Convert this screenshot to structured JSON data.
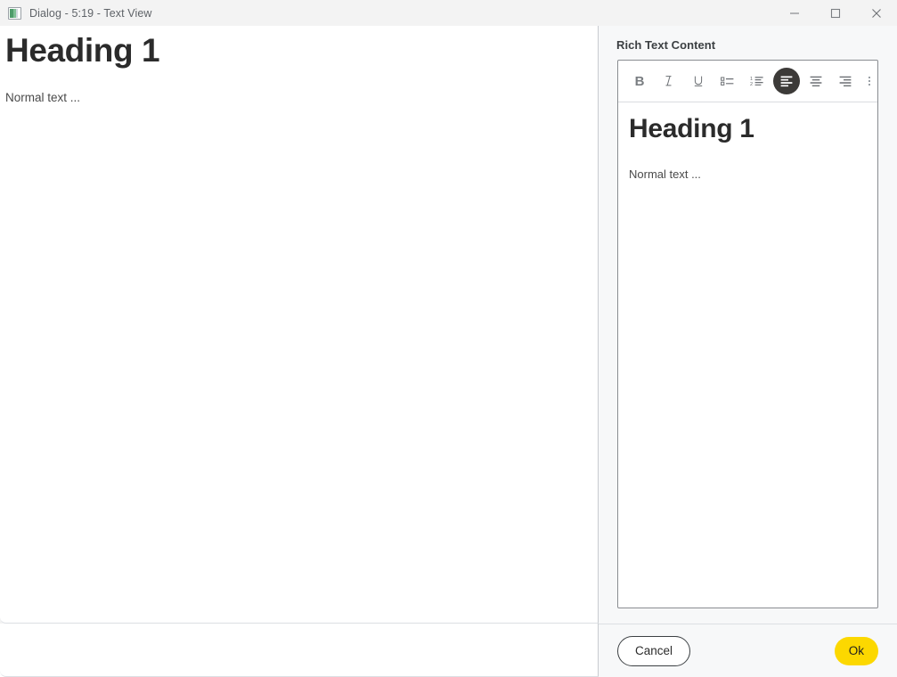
{
  "window": {
    "title": "Dialog - 5:19 - Text View",
    "icon": "image-thumbnail-icon",
    "controls": {
      "minimize": "minimize-icon",
      "maximize": "maximize-icon",
      "close": "close-icon"
    }
  },
  "document_preview": {
    "heading": "Heading 1",
    "body": "Normal text ..."
  },
  "editor_panel": {
    "label": "Rich Text Content",
    "toolbar": [
      {
        "name": "bold-icon",
        "glyph": "B",
        "active": false
      },
      {
        "name": "italic-icon",
        "glyph": "I",
        "active": false
      },
      {
        "name": "underline-icon",
        "glyph": "U",
        "active": false
      },
      {
        "name": "bulleted-list-icon",
        "glyph": "",
        "active": false
      },
      {
        "name": "numbered-list-icon",
        "glyph": "",
        "active": false
      },
      {
        "name": "align-left-icon",
        "glyph": "",
        "active": true
      },
      {
        "name": "align-center-icon",
        "glyph": "",
        "active": false
      },
      {
        "name": "align-right-icon",
        "glyph": "",
        "active": false
      },
      {
        "name": "more-options-icon",
        "glyph": "",
        "active": false
      }
    ],
    "content": {
      "heading": "Heading 1",
      "body": "Normal text ..."
    }
  },
  "footer": {
    "cancel_label": "Cancel",
    "ok_label": "Ok"
  },
  "colors": {
    "accent_yellow": "#fcd800",
    "active_toolbar": "#3c3a38",
    "panel_background": "#f7f8f9",
    "titlebar_background": "#f3f3f3"
  }
}
